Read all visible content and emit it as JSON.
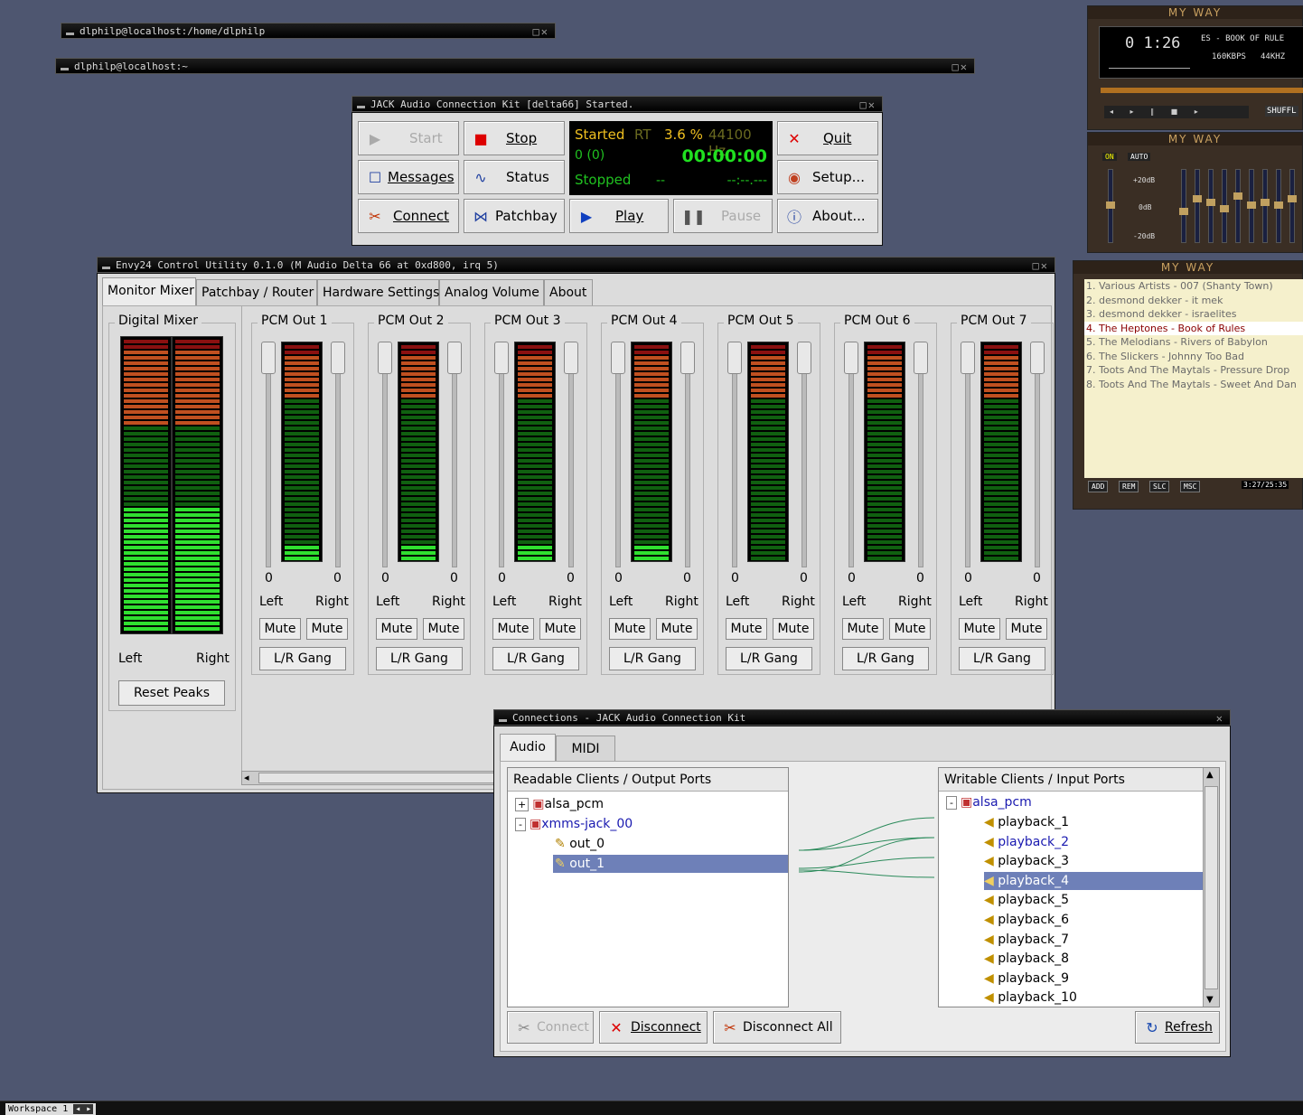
{
  "terminals": [
    {
      "title": "dlphilp@localhost:/home/dlphilp"
    },
    {
      "title": "dlphilp@localhost:~"
    }
  ],
  "jack": {
    "title": "JACK Audio Connection Kit [delta66] Started.",
    "buttons": {
      "start": "Start",
      "stop": "Stop",
      "quit": "Quit",
      "messages": "Messages",
      "status": "Status",
      "setup": "Setup...",
      "connect": "Connect",
      "patchbay": "Patchbay",
      "play": "Play",
      "pause": "Pause",
      "about": "About..."
    },
    "display": {
      "state": "Started",
      "rt": "RT",
      "cpu": "3.6 %",
      "rate": "44100 Hz",
      "xruns": "0 (0)",
      "time": "00:00:00",
      "transport": "Stopped",
      "dash": "--",
      "bbt": "--:--.---"
    }
  },
  "envy": {
    "title": "Envy24 Control Utility 0.1.0 (M Audio Delta 66 at 0xd800, irq 5)",
    "tabs": [
      "Monitor Mixer",
      "Patchbay / Router",
      "Hardware Settings",
      "Analog Volume",
      "About"
    ],
    "digital_mixer": {
      "label": "Digital Mixer",
      "left": "Left",
      "right": "Right",
      "reset": "Reset Peaks"
    },
    "channels": [
      {
        "name": "PCM Out 1",
        "level": 0.08
      },
      {
        "name": "PCM Out 2",
        "level": 0.08
      },
      {
        "name": "PCM Out 3",
        "level": 0.08
      },
      {
        "name": "PCM Out 4",
        "level": 0.08
      },
      {
        "name": "PCM Out 5",
        "level": 0.0
      },
      {
        "name": "PCM Out 6",
        "level": 0.0
      },
      {
        "name": "PCM Out 7",
        "level": 0.0
      }
    ],
    "channel_labels": {
      "zero": "0",
      "left": "Left",
      "right": "Right",
      "mute": "Mute",
      "gang": "L/R Gang"
    },
    "master_level": 0.44
  },
  "connections": {
    "title": "Connections - JACK Audio Connection Kit",
    "tabs": [
      "Audio",
      "MIDI"
    ],
    "readable_header": "Readable Clients / Output Ports",
    "writable_header": "Writable Clients / Input Ports",
    "readable": [
      {
        "label": "alsa_pcm",
        "expander": "+"
      },
      {
        "label": "xmms-jack_00",
        "expander": "-"
      },
      {
        "label": "out_0"
      },
      {
        "label": "out_1"
      }
    ],
    "writable_client": "alsa_pcm",
    "writable": [
      "playback_1",
      "playback_2",
      "playback_3",
      "playback_4",
      "playback_5",
      "playback_6",
      "playback_7",
      "playback_8",
      "playback_9",
      "playback_10"
    ],
    "buttons": {
      "connect": "Connect",
      "disconnect": "Disconnect",
      "disconnect_all": "Disconnect All",
      "refresh": "Refresh"
    }
  },
  "xmms": {
    "title": "MY WAY",
    "time": "0 1:26",
    "track": "ES - BOOK OF RULE",
    "kbps": "160KBPS",
    "khz": "44KHZ",
    "shuffle": "SHUFFL",
    "eq_on": "ON",
    "eq_auto": "AUTO",
    "eq_labels": [
      "+20dB",
      "0dB",
      "-20dB"
    ],
    "playlist": [
      "1. Various Artists - 007 (Shanty Town)",
      "2. desmond dekker - it mek",
      "3. desmond dekker - israelites",
      "4. The Heptones - Book of Rules",
      "5. The Melodians - Rivers of Babylon",
      "6. The Slickers - Johnny Too Bad",
      "7. Toots And The Maytals - Pressure Drop",
      "8. Toots And The Maytals - Sweet And Dan"
    ],
    "pl_buttons": [
      "ADD",
      "REM",
      "SLC",
      "MSC"
    ],
    "pl_time": "3:27/25:35"
  },
  "taskbar": {
    "workspace": "Workspace 1"
  }
}
